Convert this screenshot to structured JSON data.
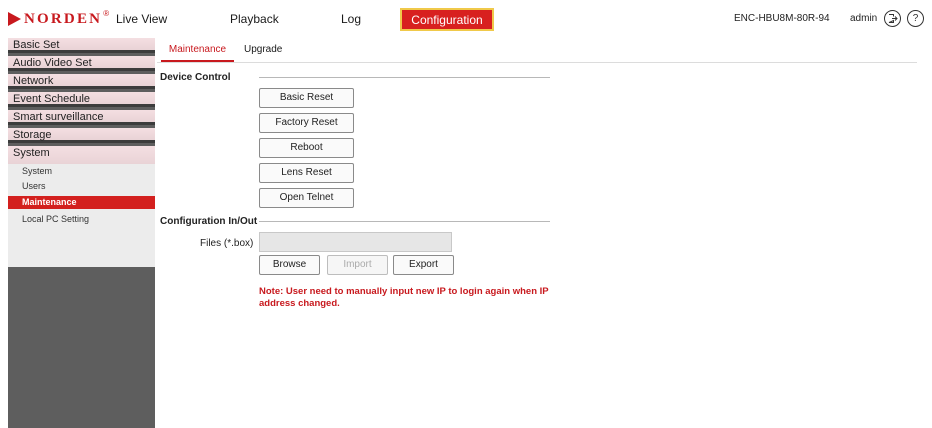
{
  "logo": {
    "text": "NORDEN",
    "registered": "®"
  },
  "nav": {
    "live_view": "Live View",
    "playback": "Playback",
    "log": "Log",
    "configuration": "Configuration"
  },
  "header": {
    "device_name": "ENC-HBU8M-80R-94",
    "user": "admin"
  },
  "sidebar": {
    "groups": [
      "Basic Set",
      "Audio Video Set",
      "Network",
      "Event Schedule",
      "Smart surveillance",
      "Storage",
      "System"
    ],
    "sub_items": [
      "System",
      "Users",
      "Maintenance",
      "Local PC Setting"
    ],
    "active_sub": "Maintenance"
  },
  "tabs": {
    "maintenance": "Maintenance",
    "upgrade": "Upgrade"
  },
  "device_control": {
    "title": "Device Control",
    "buttons": [
      "Basic Reset",
      "Factory Reset",
      "Reboot",
      "Lens Reset",
      "Open Telnet"
    ]
  },
  "config_io": {
    "title": "Configuration In/Out",
    "files_label": "Files (*.box)",
    "files_value": "",
    "browse": "Browse",
    "import": "Import",
    "export": "Export"
  },
  "note": "Note: User need to manually input new IP to login again when IP address changed.",
  "colors": {
    "accent": "#c8191e",
    "sidebar_bg": "#5e5e5e",
    "nav_active_border": "#f0c94a"
  }
}
